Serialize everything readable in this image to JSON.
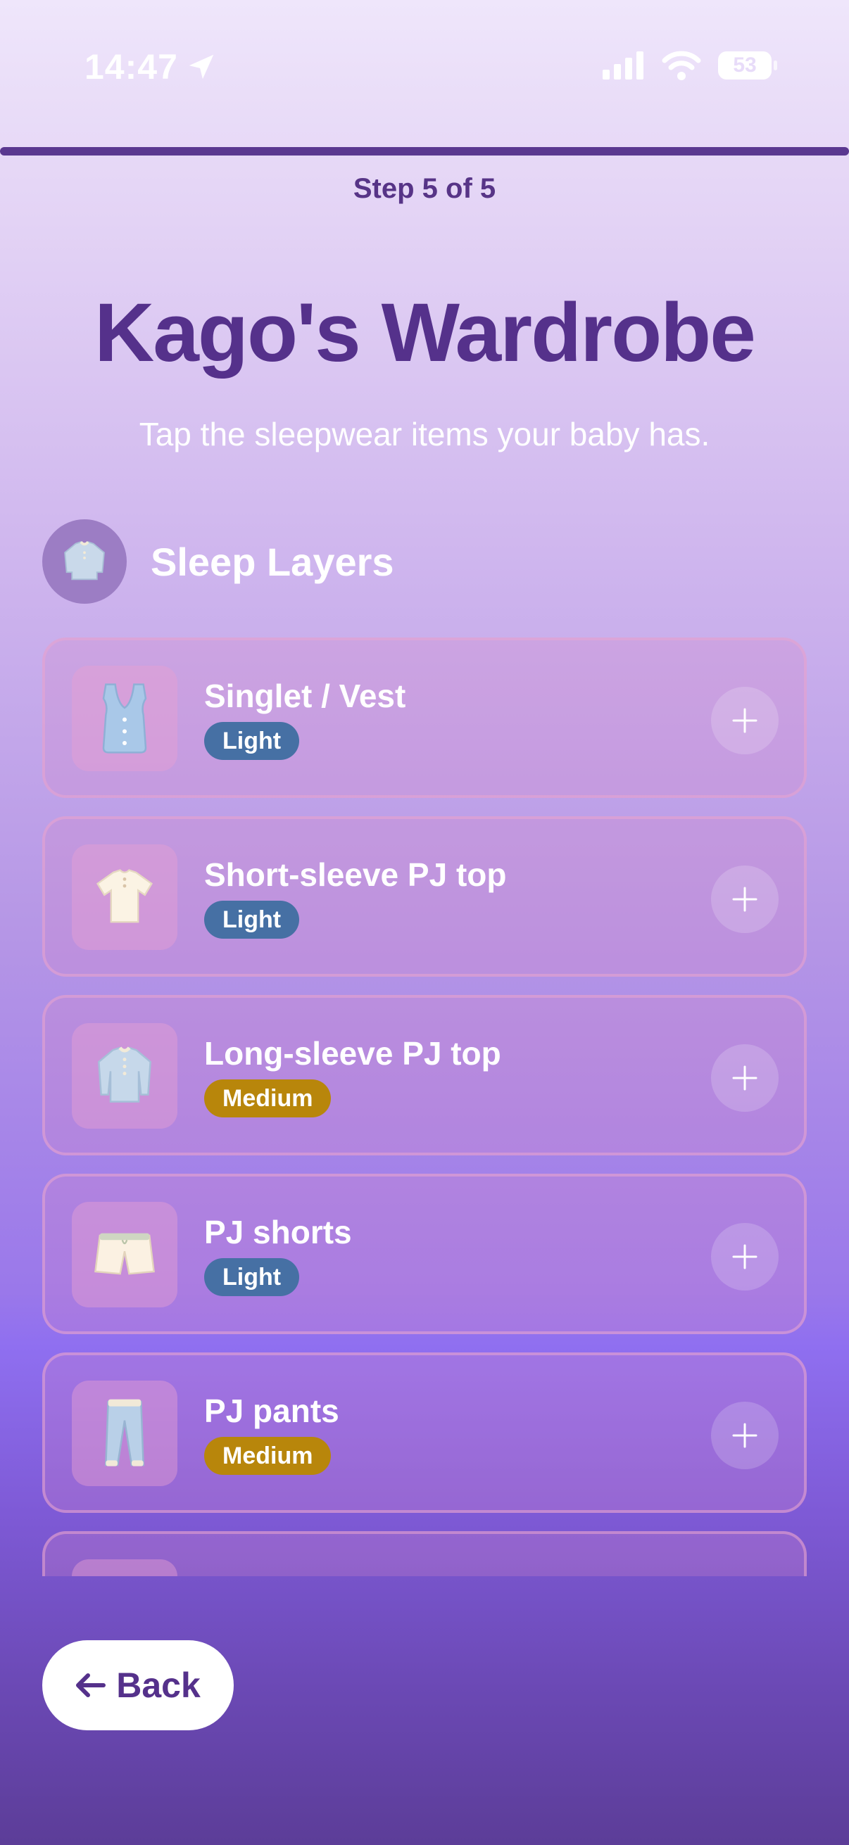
{
  "status": {
    "time": "14:47",
    "battery": "53"
  },
  "progress": {
    "step_label": "Step 5 of 5",
    "fraction": 1.0
  },
  "header": {
    "title": "Kago's Wardrobe",
    "subtitle": "Tap the sleepwear items your baby has."
  },
  "section": {
    "label": "Sleep Layers",
    "icon": "long-sleeve-top-icon"
  },
  "items": [
    {
      "name": "Singlet / Vest",
      "badge": "Light",
      "badge_color": "#4670a4",
      "icon": "vest-icon"
    },
    {
      "name": "Short-sleeve PJ top",
      "badge": "Light",
      "badge_color": "#4670a4",
      "icon": "tshirt-icon"
    },
    {
      "name": "Long-sleeve PJ top",
      "badge": "Medium",
      "badge_color": "#b8860b",
      "icon": "long-sleeve-top-icon"
    },
    {
      "name": "PJ shorts",
      "badge": "Light",
      "badge_color": "#4670a4",
      "icon": "shorts-icon"
    },
    {
      "name": "PJ pants",
      "badge": "Medium",
      "badge_color": "#b8860b",
      "icon": "pants-icon"
    }
  ],
  "footer": {
    "back_label": "Back"
  },
  "colors": {
    "accent": "#55318b",
    "light_badge": "#4670a4",
    "medium_badge": "#b8860b"
  }
}
